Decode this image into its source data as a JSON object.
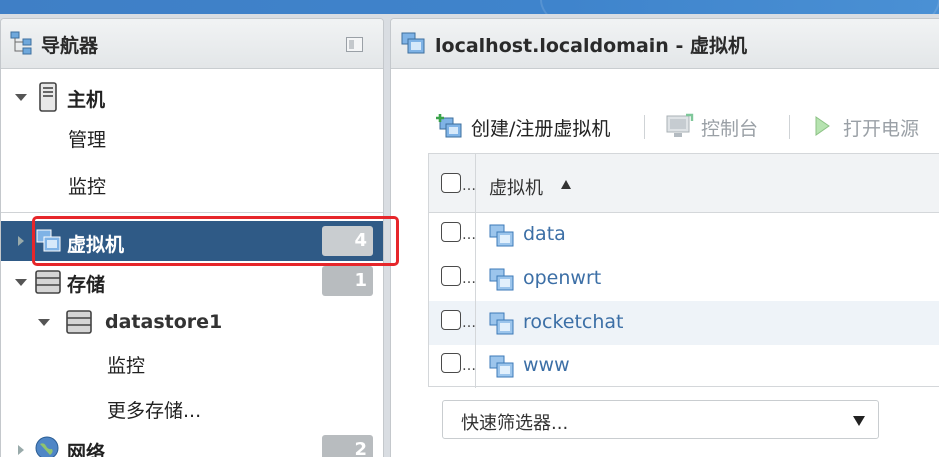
{
  "navigator": {
    "title": "导航器",
    "items": [
      {
        "label": "主机",
        "children": [
          "管理",
          "监控"
        ]
      },
      {
        "label": "虚拟机",
        "count": "4",
        "selected": true
      },
      {
        "label": "存储",
        "count": "1",
        "datastore": {
          "label": "datastore1",
          "children": [
            "监控"
          ]
        },
        "more": "更多存储..."
      },
      {
        "label": "网络",
        "count": "2"
      }
    ]
  },
  "main": {
    "title": "localhost.localdomain - 虚拟机",
    "toolbar": {
      "create": "创建/注册虚拟机",
      "console": "控制台",
      "power_on": "打开电源"
    },
    "grid": {
      "column": "虚拟机",
      "rows": [
        "data",
        "openwrt",
        "rocketchat",
        "www"
      ]
    },
    "filter": {
      "placeholder": "快速筛选器..."
    }
  },
  "colors": {
    "selected_bg": "#2f5a86",
    "link": "#3c6fa6",
    "highlight": "#e6262a"
  }
}
